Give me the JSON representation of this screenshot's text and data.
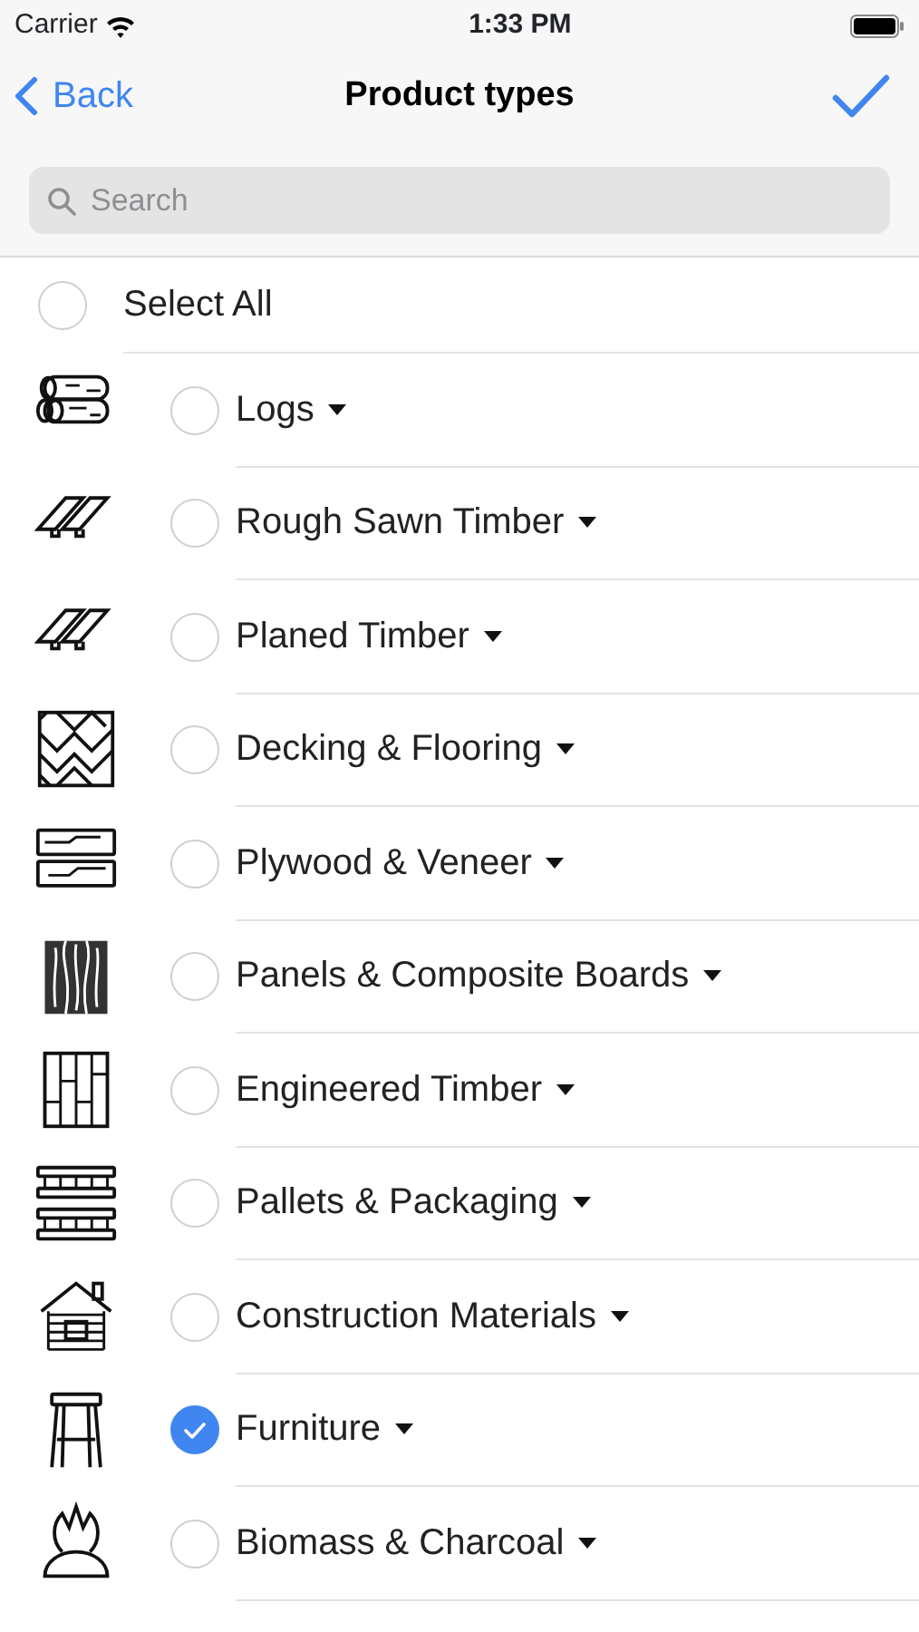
{
  "status_bar": {
    "carrier": "Carrier",
    "time": "1:33 PM"
  },
  "nav": {
    "back": "Back",
    "title": "Product types"
  },
  "search": {
    "placeholder": "Search"
  },
  "select_all": {
    "label": "Select All",
    "selected": false
  },
  "items": [
    {
      "label": "Logs",
      "selected": false
    },
    {
      "label": "Rough Sawn Timber",
      "selected": false
    },
    {
      "label": "Planed Timber",
      "selected": false
    },
    {
      "label": "Decking & Flooring",
      "selected": false
    },
    {
      "label": "Plywood & Veneer",
      "selected": false
    },
    {
      "label": "Panels & Composite Boards",
      "selected": false
    },
    {
      "label": "Engineered Timber",
      "selected": false
    },
    {
      "label": "Pallets & Packaging",
      "selected": false
    },
    {
      "label": "Construction Materials",
      "selected": false
    },
    {
      "label": "Furniture",
      "selected": true
    },
    {
      "label": "Biomass & Charcoal",
      "selected": false
    }
  ]
}
